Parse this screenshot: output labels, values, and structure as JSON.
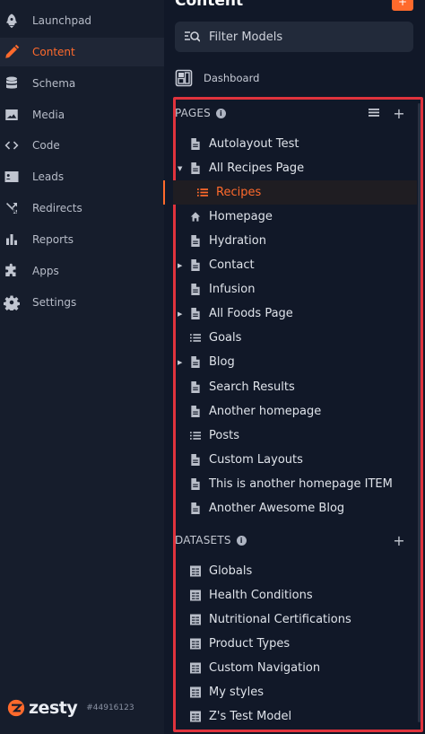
{
  "colors": {
    "accent": "#ff6a2c",
    "background": "#111828",
    "sidebar": "#161d2c",
    "highlight_border": "#e0333d"
  },
  "nav": {
    "items": [
      {
        "label": "Launchpad",
        "icon": "rocket-icon"
      },
      {
        "label": "Content",
        "icon": "pencil-icon",
        "active": true
      },
      {
        "label": "Schema",
        "icon": "database-icon"
      },
      {
        "label": "Media",
        "icon": "image-icon"
      },
      {
        "label": "Code",
        "icon": "code-icon"
      },
      {
        "label": "Leads",
        "icon": "contact-card-icon"
      },
      {
        "label": "Redirects",
        "icon": "shuffle-icon"
      },
      {
        "label": "Reports",
        "icon": "bar-chart-icon"
      },
      {
        "label": "Apps",
        "icon": "puzzle-icon"
      },
      {
        "label": "Settings",
        "icon": "gear-icon"
      }
    ],
    "brand": "zesty",
    "build": "#44916123"
  },
  "content": {
    "title": "Content",
    "new_button": "+",
    "filter_placeholder": "Filter Models",
    "dashboard_label": "Dashboard"
  },
  "pages": {
    "heading": "PAGES",
    "items": [
      {
        "label": "Autolayout Test",
        "icon": "document-icon"
      },
      {
        "label": "All Recipes Page",
        "icon": "document-icon",
        "expanded": true
      },
      {
        "label": "Recipes",
        "icon": "list-icon",
        "child": true,
        "selected": true
      },
      {
        "label": "Homepage",
        "icon": "home-icon"
      },
      {
        "label": "Hydration",
        "icon": "document-icon"
      },
      {
        "label": "Contact",
        "icon": "document-icon",
        "collapsed": true
      },
      {
        "label": "Infusion",
        "icon": "document-icon"
      },
      {
        "label": "All Foods Page",
        "icon": "document-icon",
        "collapsed": true
      },
      {
        "label": "Goals",
        "icon": "list-icon"
      },
      {
        "label": "Blog",
        "icon": "document-icon",
        "collapsed": true
      },
      {
        "label": "Search Results",
        "icon": "document-icon"
      },
      {
        "label": "Another homepage",
        "icon": "document-icon"
      },
      {
        "label": "Posts",
        "icon": "list-icon"
      },
      {
        "label": "Custom Layouts",
        "icon": "document-icon"
      },
      {
        "label": "This is another homepage ITEM",
        "icon": "document-icon"
      },
      {
        "label": "Another Awesome Blog",
        "icon": "document-icon"
      }
    ]
  },
  "datasets": {
    "heading": "DATASETS",
    "items": [
      {
        "label": "Globals",
        "icon": "dataset-icon"
      },
      {
        "label": "Health Conditions",
        "icon": "dataset-icon"
      },
      {
        "label": "Nutritional Certifications",
        "icon": "dataset-icon"
      },
      {
        "label": "Product Types",
        "icon": "dataset-icon"
      },
      {
        "label": "Custom Navigation",
        "icon": "dataset-icon"
      },
      {
        "label": "My styles",
        "icon": "dataset-icon"
      },
      {
        "label": "Z's Test Model",
        "icon": "dataset-icon"
      }
    ]
  }
}
